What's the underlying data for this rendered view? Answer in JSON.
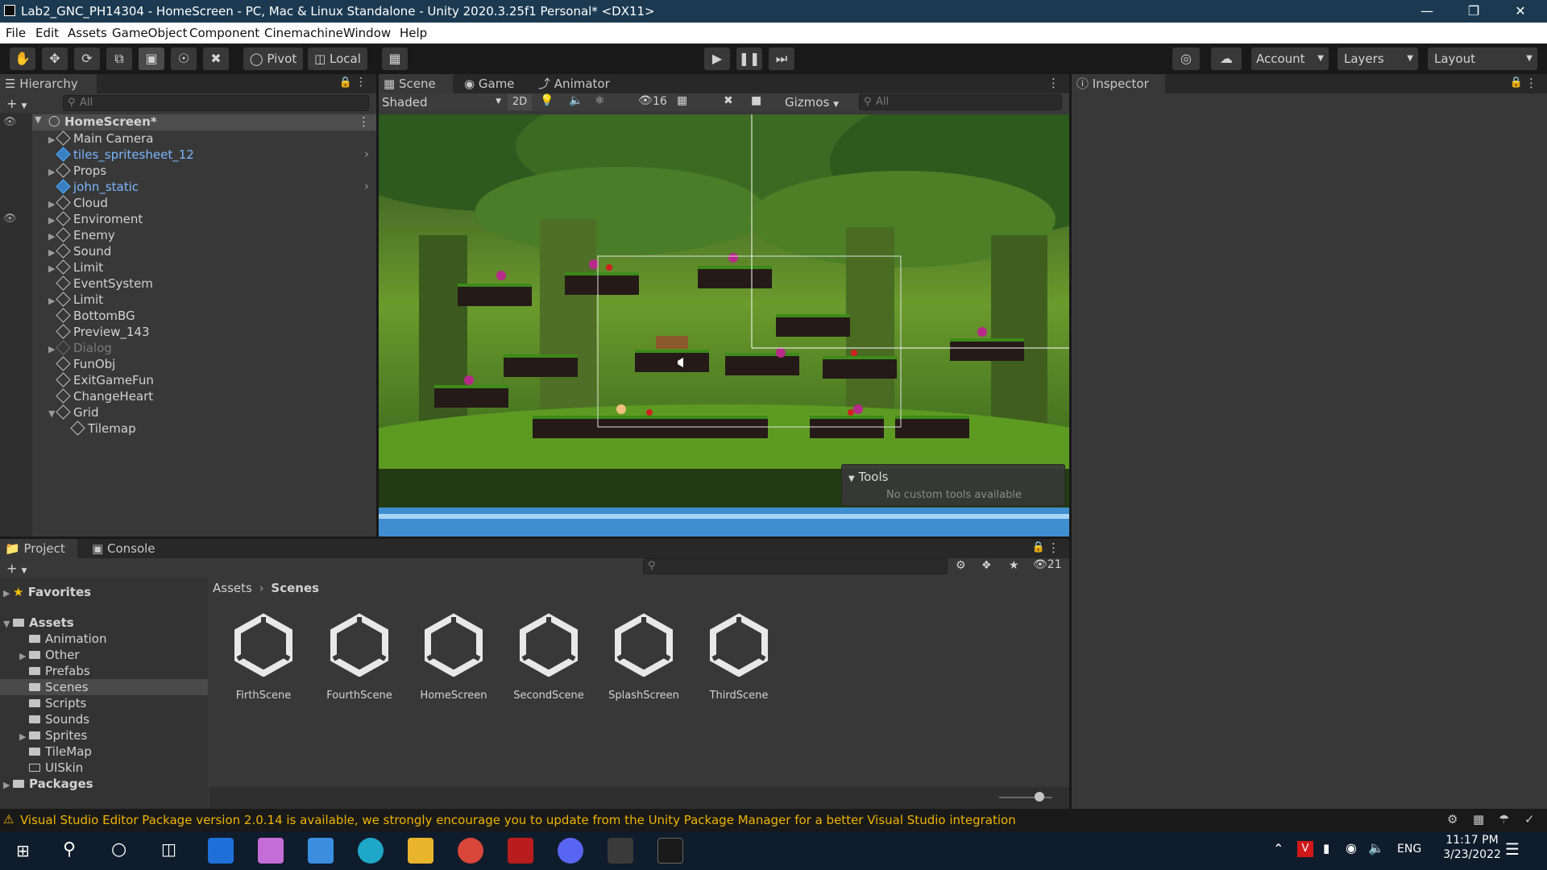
{
  "window": {
    "title": "Lab2_GNC_PH14304 - HomeScreen - PC, Mac & Linux Standalone - Unity 2020.3.25f1 Personal* <DX11>"
  },
  "menu": [
    "File",
    "Edit",
    "Assets",
    "GameObject",
    "Component",
    "Cinemachine",
    "Window",
    "Help"
  ],
  "toolbar": {
    "pivot_label": "Pivot",
    "local_label": "Local",
    "account_label": "Account",
    "layers_label": "Layers",
    "layout_label": "Layout"
  },
  "hierarchy": {
    "tab_label": "Hierarchy",
    "search_placeholder": "All",
    "scene_name": "HomeScreen*",
    "items": [
      {
        "label": "Main Camera"
      },
      {
        "label": "tiles_spritesheet_12"
      },
      {
        "label": "Props"
      },
      {
        "label": "john_static"
      },
      {
        "label": "Cloud"
      },
      {
        "label": "Enviroment"
      },
      {
        "label": "Enemy"
      },
      {
        "label": "Sound"
      },
      {
        "label": "Limit"
      },
      {
        "label": "EventSystem"
      },
      {
        "label": "Limit"
      },
      {
        "label": "BottomBG"
      },
      {
        "label": "Preview_143"
      },
      {
        "label": "Dialog"
      },
      {
        "label": "FunObj"
      },
      {
        "label": "ExitGameFun"
      },
      {
        "label": "ChangeHeart"
      },
      {
        "label": "Grid"
      },
      {
        "label": "Tilemap"
      }
    ]
  },
  "scene_view": {
    "tabs": [
      "Scene",
      "Game",
      "Animator"
    ],
    "shading": "Shaded",
    "mode_2d": "2D",
    "hidden_count": "16",
    "gizmos_label": "Gizmos",
    "search_placeholder": "All",
    "tools_title": "Tools",
    "tools_message": "No custom tools available"
  },
  "inspector": {
    "tab_label": "Inspector"
  },
  "project": {
    "tabs": [
      "Project",
      "Console"
    ],
    "hidden_count": "21",
    "favorites_label": "Favorites",
    "assets_label": "Assets",
    "folders": [
      "Animation",
      "Other",
      "Prefabs",
      "Scenes",
      "Scripts",
      "Sounds",
      "Sprites",
      "TileMap",
      "UISkin"
    ],
    "packages_label": "Packages",
    "breadcrumb": [
      "Assets",
      "Scenes"
    ],
    "scenes": [
      "FirthScene",
      "FourthScene",
      "HomeScreen",
      "SecondScene",
      "SplashScreen",
      "ThirdScene"
    ]
  },
  "status": {
    "message": "Visual Studio Editor Package version 2.0.14 is available, we strongly encourage you to update from the Unity Package Manager for a better Visual Studio integration"
  },
  "taskbar": {
    "language": "ENG",
    "time": "11:17 PM",
    "date": "3/23/2022"
  },
  "colors": {
    "accent_selected": "#2c5d87",
    "warning": "#f0b400",
    "prefab_blue": "#7ab7ff"
  }
}
